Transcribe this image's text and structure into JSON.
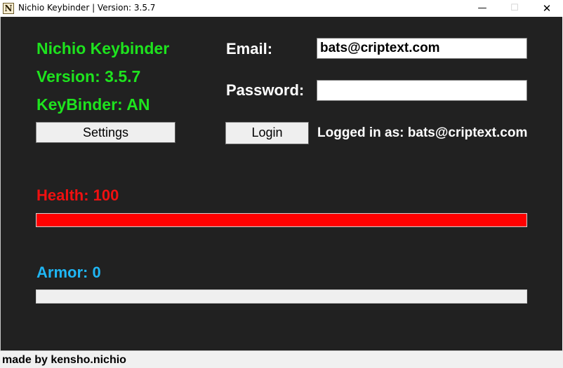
{
  "window": {
    "title": "Nichio Keybinder | Version: 3.5.7",
    "icon_glyph": "N",
    "minimize_glyph": "—",
    "maximize_glyph": "☐",
    "close_glyph": "✕"
  },
  "info": {
    "app_name": "Nichio Keybinder",
    "version": "Version: 3.5.7",
    "keybinder": "KeyBinder: AN"
  },
  "buttons": {
    "settings": "Settings",
    "login": "Login"
  },
  "login_form": {
    "email_label": "Email:",
    "email_value": "bats@criptext.com",
    "password_label": "Password:",
    "password_value": "",
    "status": "Logged in as: bats@criptext.com"
  },
  "stats": {
    "health_label": "Health: 100",
    "health_value": 100,
    "health_max": 100,
    "armor_label": "Armor: 0",
    "armor_value": 0,
    "armor_max": 100
  },
  "colors": {
    "background": "#212121",
    "info_text": "#1ee31e",
    "health": "#ff0000",
    "armor": "#1fb6f4"
  },
  "statusbar": {
    "text": "made by kensho.nichio"
  }
}
